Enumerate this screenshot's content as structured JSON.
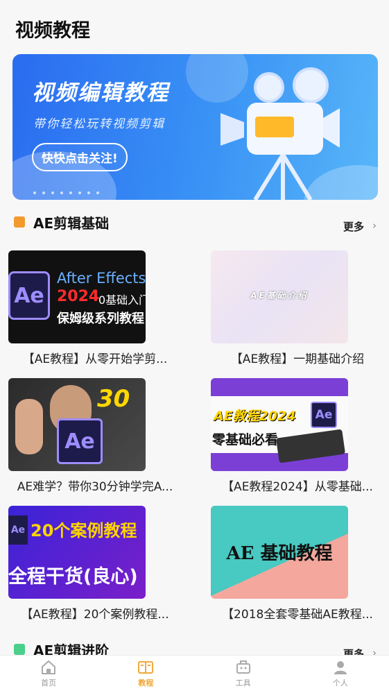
{
  "header": {
    "title": "视频教程"
  },
  "banner": {
    "title": "视频编辑教程",
    "subtitle": "带你轻松玩转视频剪辑",
    "button": "快快点击关注!"
  },
  "sections": [
    {
      "title": "AE剪辑基础",
      "more": "更多",
      "items": [
        {
          "caption": "【AE教程】从零开始学剪...",
          "thumb_lines": [
            "After Effects",
            "2024",
            "0基础入门",
            "保姆级系列教程"
          ]
        },
        {
          "caption": "【AE教程】一期基础介绍",
          "thumb_lines": [
            "AE基础介绍"
          ]
        },
        {
          "caption": "AE难学？带你30分钟学完A...",
          "thumb_lines": [
            "30"
          ]
        },
        {
          "caption": "【AE教程2024】从零基础...",
          "thumb_lines": [
            "AE教程2024",
            "零基础必看"
          ]
        },
        {
          "caption": "【AE教程】20个案例教程...",
          "thumb_lines": [
            "20个案例教程",
            "全程干货(良心)"
          ]
        },
        {
          "caption": "【2018全套零基础AE教程...",
          "thumb_lines": [
            "AE 基础教程"
          ]
        }
      ]
    },
    {
      "title": "AE剪辑进阶",
      "more": "更多"
    }
  ],
  "tabbar": [
    {
      "label": "首页",
      "icon": "home-icon",
      "active": false
    },
    {
      "label": "教程",
      "icon": "book-icon",
      "active": true
    },
    {
      "label": "工具",
      "icon": "toolbox-icon",
      "active": false
    },
    {
      "label": "个人",
      "icon": "person-icon",
      "active": false
    }
  ],
  "colors": {
    "accent": "#f0a93b",
    "banner": "#2a6cf0"
  }
}
